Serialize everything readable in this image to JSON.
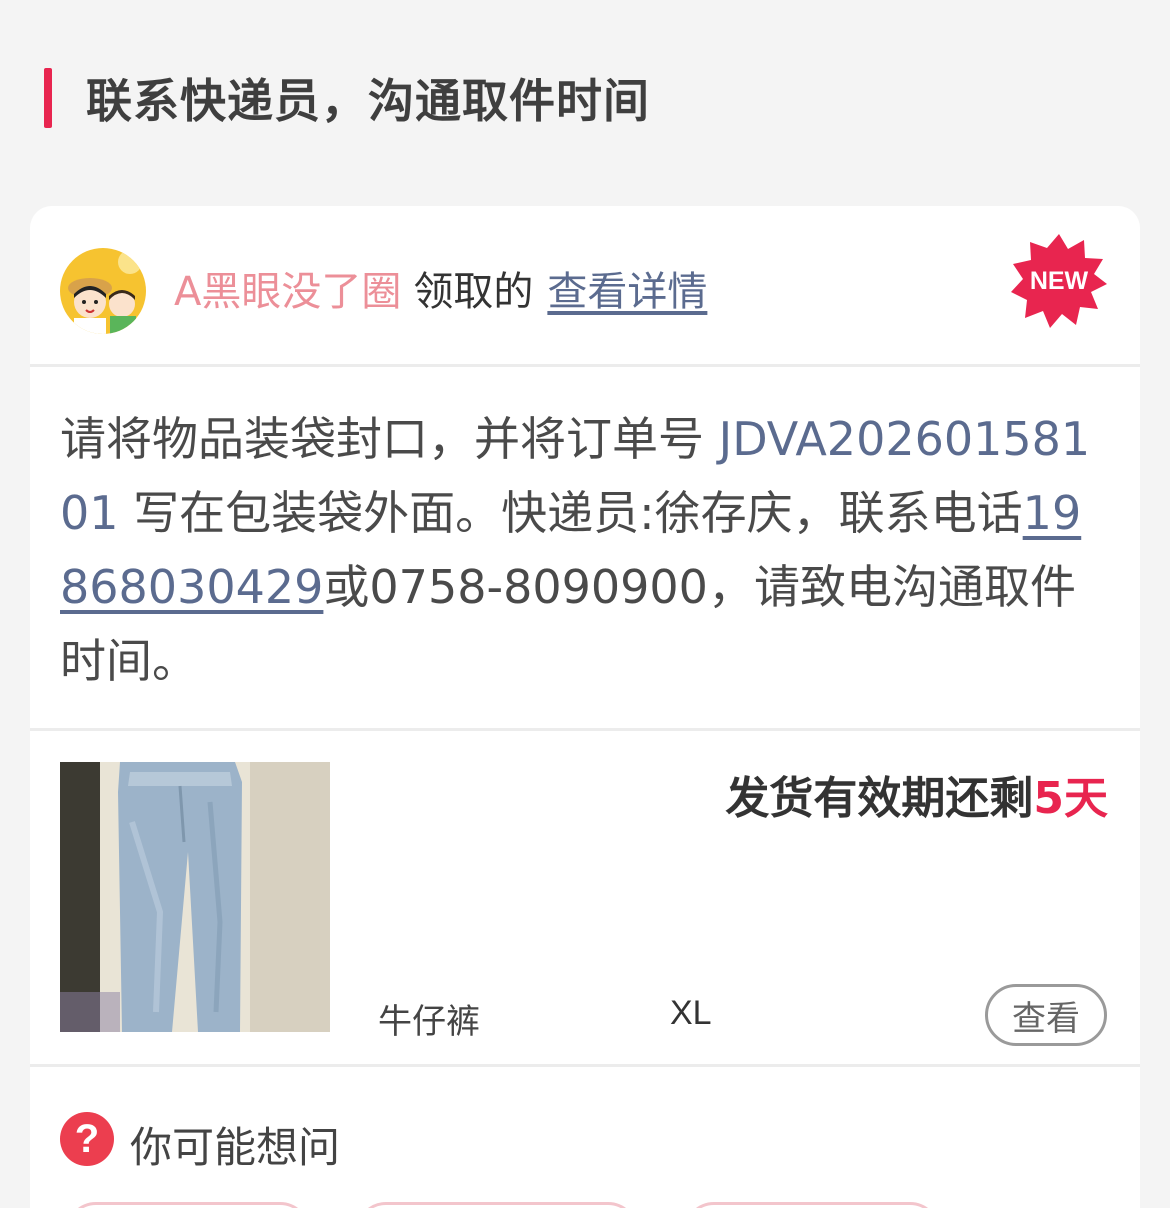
{
  "section": {
    "title": "联系快递员，沟通取件时间"
  },
  "claim": {
    "claimer_name": "A黑眼没了圈",
    "verb": "领取的",
    "detail_link": "查看详情",
    "badge": "NEW"
  },
  "instruction": {
    "part1": "请将物品装袋封口，并将订单号 ",
    "order_no": "JDVA20260158101",
    "part2": " 写在包装袋外面。快递员:徐存庆，联系电话",
    "phone_mobile": "19868030429",
    "part3": "或0758-8090900，请致电沟通取件时间。"
  },
  "item": {
    "deadline_prefix": "发货有效期还剩",
    "deadline_days": "5天",
    "name": "牛仔裤",
    "size": "XL",
    "view_button": "查看"
  },
  "faq": {
    "icon": "question-icon",
    "title": "你可能想问"
  },
  "colors": {
    "accent_red": "#e8254f",
    "link_blue": "#5b6b8f",
    "claimer_pink": "#ec8f98"
  }
}
